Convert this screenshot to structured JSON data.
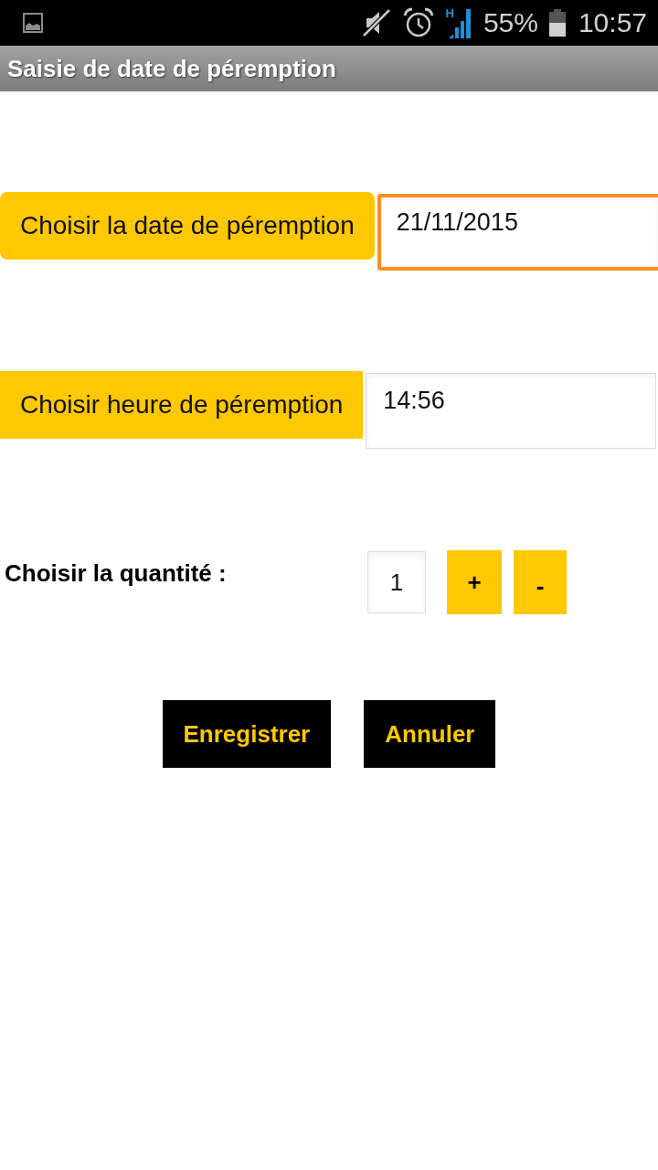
{
  "status_bar": {
    "network_type": "H",
    "battery": "55%",
    "time": "10:57"
  },
  "title_bar": {
    "title": "Saisie de date de péremption"
  },
  "pickers": [
    {
      "kind": "rounded",
      "button": "Choisir la date de péremption",
      "value": "21/11/2015",
      "focused": true
    },
    {
      "kind": "flat",
      "button": "Choisir heure de péremption",
      "value": "14:56",
      "focused": false
    }
  ],
  "quantity": {
    "label": "Choisir la quantité :",
    "value": "1",
    "increment": "+",
    "decrement": "-"
  },
  "actions": [
    "Enregistrer",
    "Annuler"
  ]
}
